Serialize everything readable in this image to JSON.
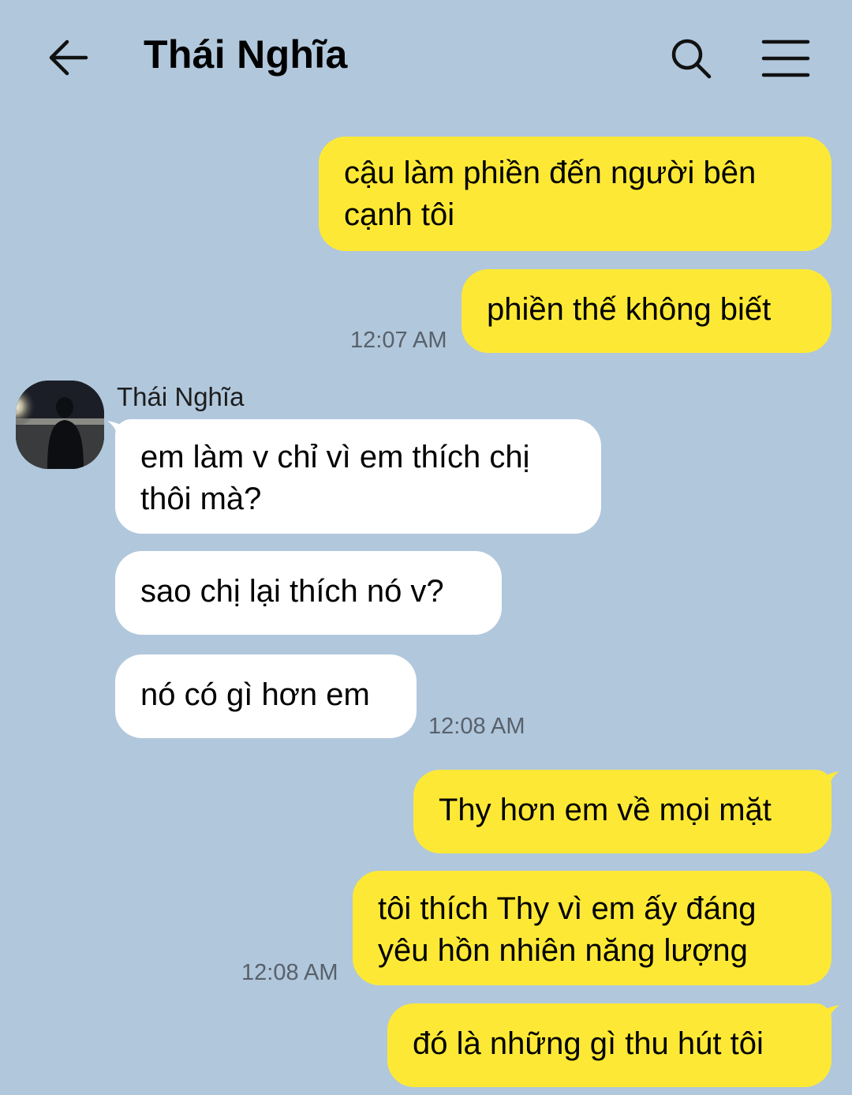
{
  "header": {
    "title": "Thái Nghĩa",
    "back_icon": "arrow-left-icon",
    "search_icon": "search-icon",
    "menu_icon": "hamburger-menu-icon"
  },
  "colors": {
    "background": "#b1c7dc",
    "outgoing_bubble": "#fde935",
    "incoming_bubble": "#ffffff",
    "timestamp": "#58616b"
  },
  "conversation": {
    "group1": {
      "msg1_line1": "cậu làm phiền đến người bên",
      "msg1_line2": "cạnh tôi",
      "msg2": "phiền thế không biết",
      "time": "12:07 AM"
    },
    "group2": {
      "sender": "Thái Nghĩa",
      "msg1_line1": "em làm v chỉ vì em thích chị",
      "msg1_line2": "thôi mà?",
      "msg2": "sao chị lại thích nó v?",
      "msg3": "nó có gì hơn em",
      "time": "12:08 AM"
    },
    "group3": {
      "msg1": "Thy hơn em về mọi mặt",
      "msg2_line1": "tôi thích Thy vì em ấy đáng",
      "msg2_line2": "yêu hồn nhiên năng lượng",
      "time": "12:08 AM",
      "msg3": "đó là những gì thu hút tôi"
    }
  }
}
